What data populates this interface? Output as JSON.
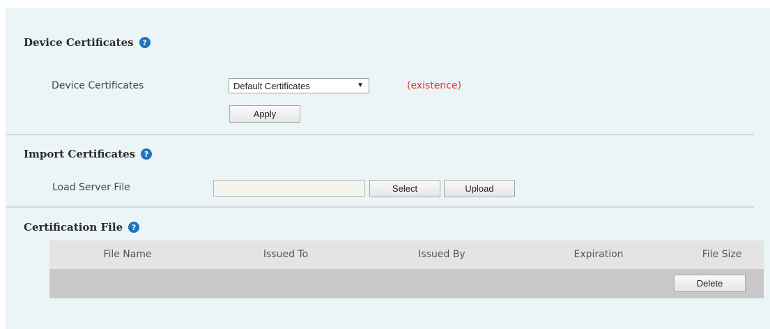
{
  "device_section": {
    "title": "Device Certificates",
    "field_label": "Device Certificates",
    "select_value": "Default Certificates",
    "status": "(existence)",
    "apply_label": "Apply"
  },
  "import_section": {
    "title": "Import Certificates",
    "field_label": "Load Server File",
    "file_value": "",
    "select_label": "Select",
    "upload_label": "Upload"
  },
  "cert_file_section": {
    "title": "Certification File",
    "columns": [
      "File Name",
      "Issued To",
      "Issued By",
      "Expiration",
      "File Size"
    ],
    "delete_label": "Delete"
  },
  "colors": {
    "panel_bg": "#ebf4f7",
    "help_icon": "#1e73be",
    "status_red": "#e8332a"
  },
  "icons": {
    "help": "question-circle"
  }
}
